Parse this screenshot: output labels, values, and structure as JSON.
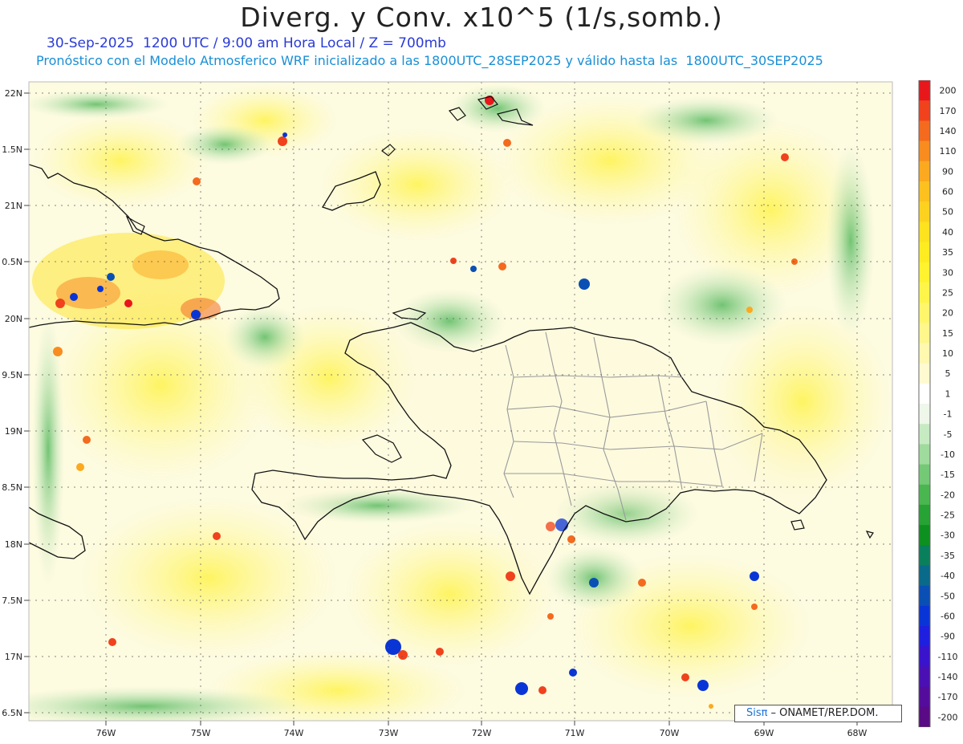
{
  "header": {
    "title": "Diverg. y Conv. x10^5 (1/s,somb.)",
    "subtitle_time": "30-Sep-2025  1200 UTC / 9:00 am Hora Local / Z = 700mb",
    "subtitle_model": "Pronóstico con el Modelo Atmosferico WRF inicializado a las 1800UTC_28SEP2025 y válido hasta las  1800UTC_30SEP2025"
  },
  "map": {
    "lat_labels": [
      "22N",
      "1.5N",
      "21N",
      "0.5N",
      "20N",
      "9.5N",
      "19N",
      "8.5N",
      "18N",
      "7.5N",
      "17N",
      "6.5N"
    ],
    "lon_labels": [
      "76W",
      "75W",
      "74W",
      "73W",
      "72W",
      "71W",
      "70W",
      "69W",
      "68W"
    ]
  },
  "legend": {
    "labels": [
      "200",
      "170",
      "140",
      "110",
      "90",
      "60",
      "50",
      "40",
      "35",
      "30",
      "25",
      "20",
      "15",
      "10",
      "5",
      "1",
      "-1",
      "-5",
      "-10",
      "-15",
      "-20",
      "-25",
      "-30",
      "-35",
      "-40",
      "-50",
      "-60",
      "-90",
      "-110",
      "-140",
      "-170",
      "-200"
    ],
    "colors": [
      "#e8171c",
      "#f0421d",
      "#f46a1e",
      "#f88c1f",
      "#fba91f",
      "#fdc11f",
      "#fdd21f",
      "#fde21f",
      "#feec21",
      "#fef32e",
      "#fff54a",
      "#fff66b",
      "#fff68c",
      "#fff8af",
      "#fffad0",
      "#ffffff",
      "#eef7ea",
      "#c6ebc3",
      "#9fdb9c",
      "#74c976",
      "#4ab650",
      "#27a234",
      "#0e9020",
      "#0a7f5b",
      "#0a6a8a",
      "#0a4fb4",
      "#0a35d6",
      "#1f1fe0",
      "#3a14cc",
      "#4a10b4",
      "#540c9c",
      "#5a0a84"
    ]
  },
  "credit": {
    "logo": "Sisπ",
    "text": "– ONAMET/REP.DOM."
  }
}
